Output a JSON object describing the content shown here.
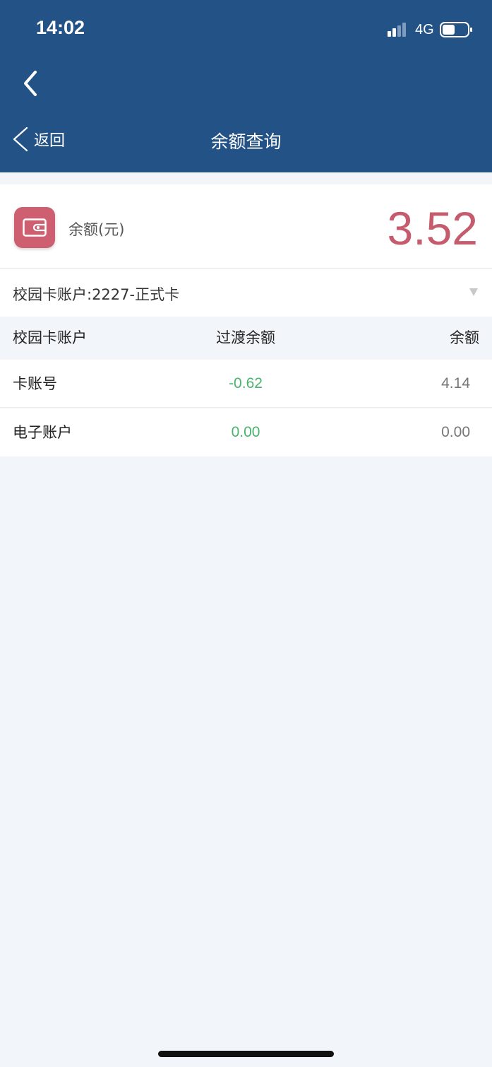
{
  "status_bar": {
    "time": "14:02",
    "network": "4G",
    "signal_icon": "cellular-signal-icon",
    "battery_icon": "battery-icon"
  },
  "top_back_icon": "chevron-left-icon",
  "navbar": {
    "back_label": "返回",
    "title": "余额查询",
    "background": "#235287"
  },
  "balance": {
    "icon": "wallet-icon",
    "label": "余额(元)",
    "value": "3.52",
    "value_color": "#c55c6d"
  },
  "account_select": {
    "selected": "校园卡账户:2227-正式卡"
  },
  "table": {
    "headers": [
      "校园卡账户",
      "过渡余额",
      "余额"
    ],
    "rows": [
      {
        "name": "卡账号",
        "transition": "-0.62",
        "balance": "4.14"
      },
      {
        "name": "电子账户",
        "transition": "0.00",
        "balance": "0.00"
      }
    ],
    "transition_color": "#4bb36e"
  }
}
